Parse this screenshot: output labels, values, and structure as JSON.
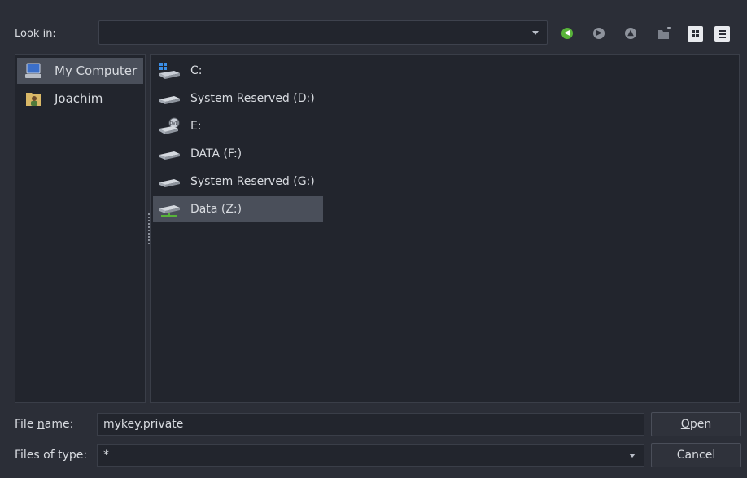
{
  "look_in": {
    "label": "Look in:",
    "value": ""
  },
  "toolbar": {
    "back_icon": "back-arrow-icon",
    "forward_icon": "forward-arrow-icon",
    "up_icon": "up-arrow-icon",
    "new_folder_icon": "new-folder-icon",
    "list_view_icon": "list-view-icon",
    "detail_view_icon": "detail-view-icon"
  },
  "sidebar": {
    "items": [
      {
        "label": "My Computer",
        "icon": "computer-icon",
        "selected": true
      },
      {
        "label": "Joachim",
        "icon": "user-folder-icon",
        "selected": false
      }
    ]
  },
  "files": [
    {
      "label": "C:",
      "icon": "windows-drive-icon",
      "selected": false
    },
    {
      "label": "System Reserved (D:)",
      "icon": "hard-drive-icon",
      "selected": false
    },
    {
      "label": "E:",
      "icon": "dvd-drive-icon",
      "selected": false
    },
    {
      "label": "DATA (F:)",
      "icon": "hard-drive-icon",
      "selected": false
    },
    {
      "label": "System Reserved (G:)",
      "icon": "hard-drive-icon",
      "selected": false
    },
    {
      "label": "Data (Z:)",
      "icon": "network-drive-icon",
      "selected": true
    }
  ],
  "file_name": {
    "label_pre": "File ",
    "label_u": "n",
    "label_post": "ame:",
    "value": "mykey.private"
  },
  "files_of_type": {
    "label": "Files of type:",
    "value": "*"
  },
  "buttons": {
    "open_u": "O",
    "open_rest": "pen",
    "cancel": "Cancel"
  },
  "colors": {
    "background": "#2b2e37",
    "panel": "#22252d",
    "selection": "#4a4f5a",
    "accent_green": "#58b33a"
  }
}
